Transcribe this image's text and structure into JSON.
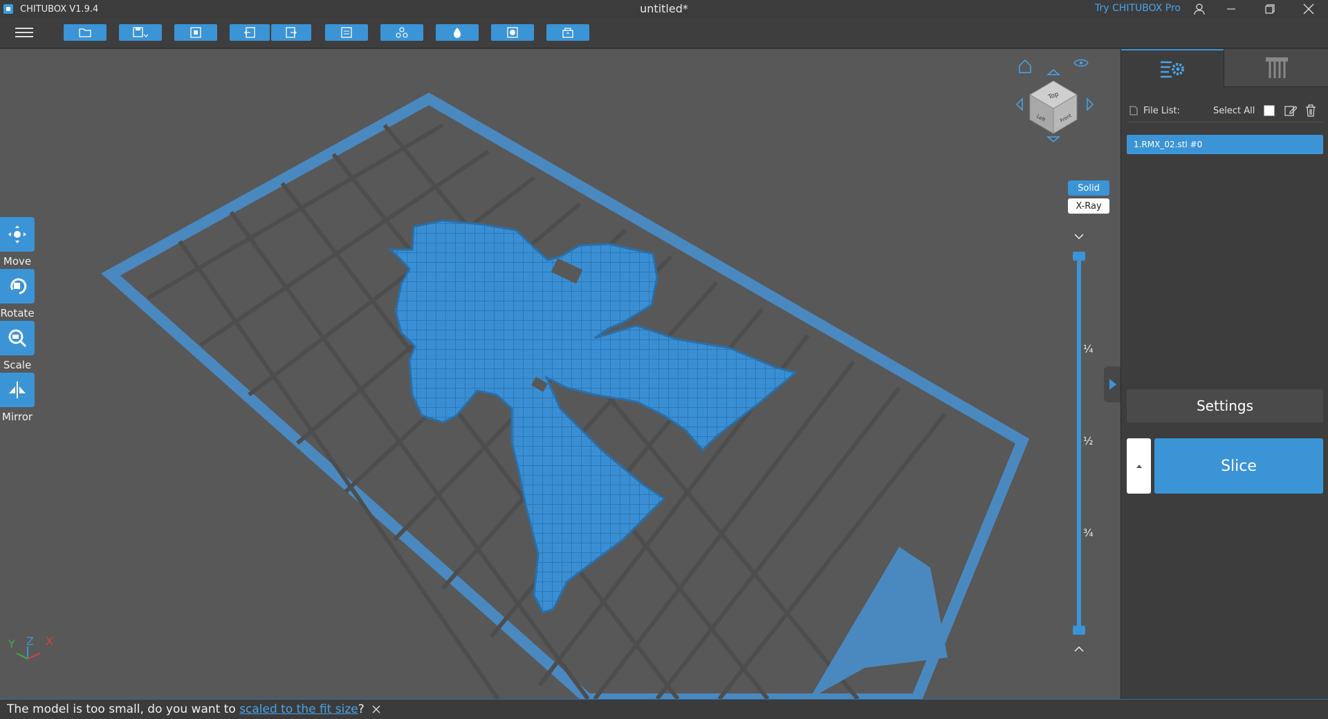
{
  "titlebar": {
    "app_name": "CHITUBOX V1.9.4",
    "document_title": "untitled*",
    "try_pro": "Try CHITUBOX Pro"
  },
  "toolbar": {
    "buttons": [
      "open-icon",
      "save-icon",
      "fit-icon",
      "undo-icon",
      "redo-icon",
      "layout-icon",
      "arrange-icon",
      "hollow-icon",
      "screenshot-icon",
      "package-icon"
    ]
  },
  "tools": [
    {
      "label": "Move"
    },
    {
      "label": "Rotate"
    },
    {
      "label": "Scale"
    },
    {
      "label": "Mirror"
    }
  ],
  "view_cube": {
    "top": "Top",
    "left": "Left",
    "front": "Front"
  },
  "view_modes": {
    "solid": "Solid",
    "xray": "X-Ray",
    "active": "Solid"
  },
  "layer_slider": {
    "marks": [
      "¼",
      "½",
      "¾"
    ]
  },
  "axes": {
    "y": "Y",
    "z": "Z",
    "x": "X"
  },
  "right_panel": {
    "file_list_label": "File List:",
    "select_all_label": "Select All",
    "files": [
      "1.RMX_02.stl #0"
    ],
    "settings_label": "Settings",
    "slice_label": "Slice"
  },
  "status": {
    "prefix": "The model is too small, do you want to ",
    "link": "scaled to the fit size",
    "suffix": "?"
  },
  "colors": {
    "accent": "#3b94d6",
    "viewport_bg": "#585858",
    "panel_bg": "#3d3d3d"
  }
}
